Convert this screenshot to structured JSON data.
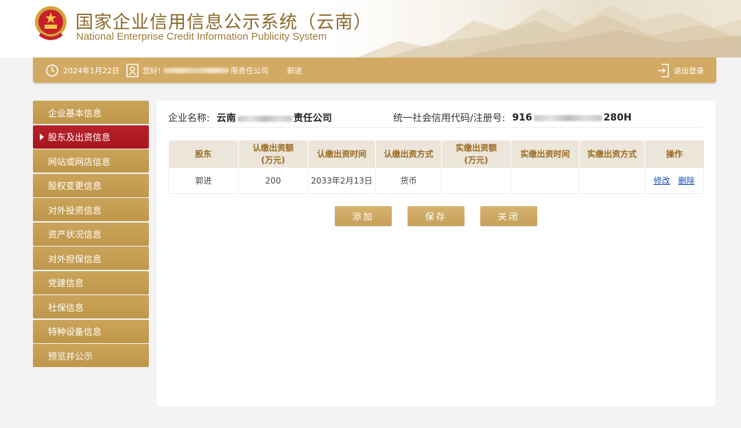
{
  "header": {
    "title_zh": "国家企业信用信息公示系统（云南）",
    "title_en": "National Enterprise Credit Information Publicity System"
  },
  "topbar": {
    "date": "2024年1月22日",
    "greeting": "您好!",
    "company_suffix": "限责任公司",
    "user_name": "郭进",
    "logout": "退出登录"
  },
  "sidebar": {
    "items": [
      {
        "label": "企业基本信息"
      },
      {
        "label": "股东及出资信息"
      },
      {
        "label": "网站或网店信息"
      },
      {
        "label": "股权变更信息"
      },
      {
        "label": "对外投资信息"
      },
      {
        "label": "资产状况信息"
      },
      {
        "label": "对外担保信息"
      },
      {
        "label": "党建信息"
      },
      {
        "label": "社保信息"
      },
      {
        "label": "特种设备信息"
      },
      {
        "label": "预览并公示"
      }
    ],
    "active_index": 1
  },
  "main": {
    "company_label": "企业名称:",
    "company_prefix": "云南",
    "company_suffix": "责任公司",
    "credit_label": "统一社会信用代码/注册号:",
    "credit_prefix": "916",
    "credit_suffix": "280H",
    "table": {
      "headers": [
        "股东",
        "认缴出资额\n(万元)",
        "认缴出资时间",
        "认缴出资方式",
        "实缴出资额\n(万元)",
        "实缴出资时间",
        "实缴出资方式",
        "操作"
      ],
      "rows": [
        {
          "shareholder": "郭进",
          "subscribed_amount": "200",
          "subscribed_date": "2033年2月13日",
          "subscribed_method": "货币",
          "paid_amount": "",
          "paid_date": "",
          "paid_method": "",
          "edit": "修改",
          "delete": "删除"
        }
      ]
    },
    "buttons": {
      "add": "添加",
      "save": "保存",
      "close": "关闭"
    }
  },
  "colors": {
    "gold": "#d2aa63",
    "menu_gold": "#c49d52",
    "active_red": "#b01a24",
    "header_text": "#9a6a1e",
    "link": "#1a4fb5"
  }
}
